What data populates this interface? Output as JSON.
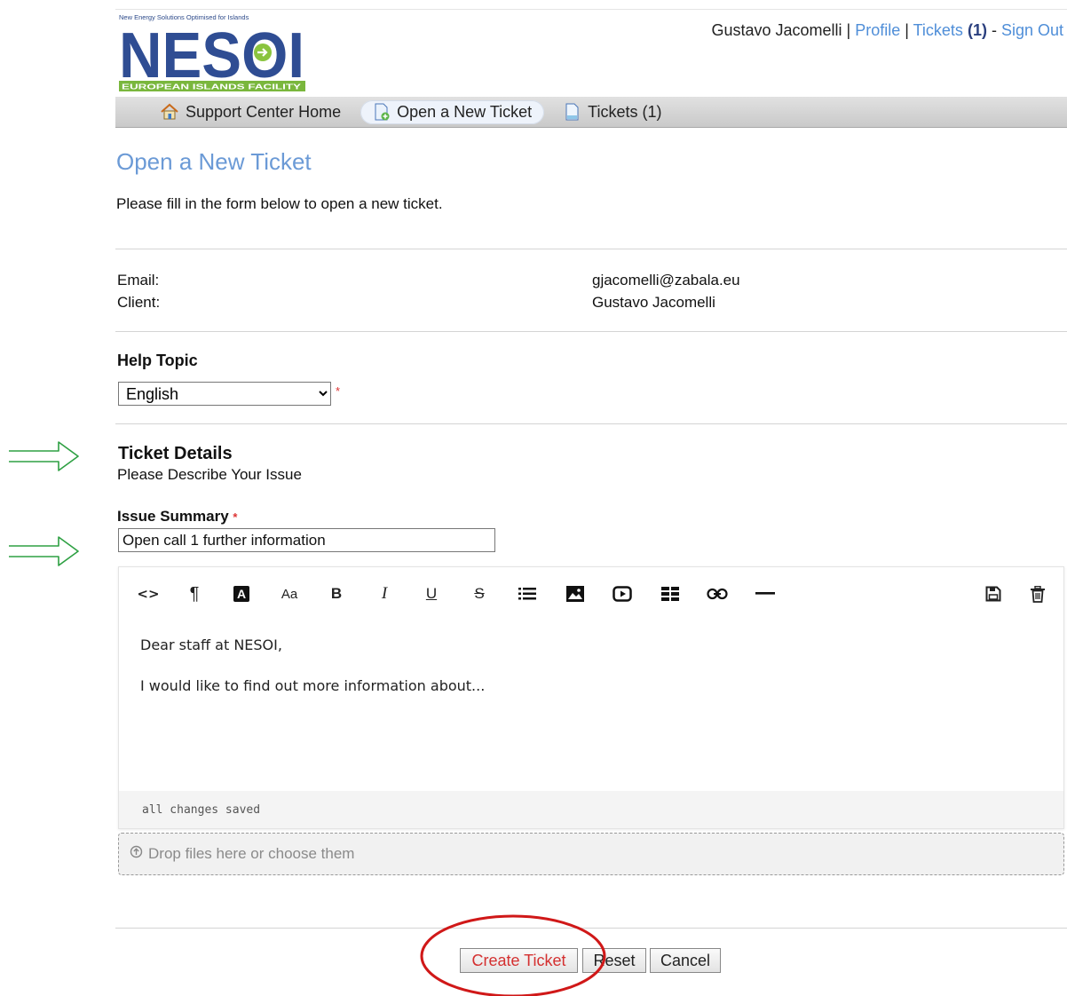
{
  "header": {
    "logo": {
      "tagline": "New Energy Solutions Optimised for Islands",
      "wordmark": "NESOI",
      "facility": "EUROPEAN ISLANDS FACILITY"
    },
    "user_bar": {
      "user_name": "Gustavo Jacomelli",
      "sep1": " | ",
      "profile": "Profile",
      "sep2": " | ",
      "tickets": "Tickets",
      "tickets_count": "(1)",
      "sep3": " - ",
      "sign_out": "Sign Out"
    }
  },
  "nav": {
    "items": [
      {
        "label": "Support Center Home",
        "icon": "home-icon"
      },
      {
        "label": "Open a New Ticket",
        "icon": "new-ticket-icon"
      },
      {
        "label": "Tickets (1)",
        "icon": "tickets-icon"
      }
    ]
  },
  "page": {
    "title": "Open a New Ticket",
    "intro": "Please fill in the form below to open a new ticket."
  },
  "client_info": {
    "email_label": "Email:",
    "email_value": "gjacomelli@zabala.eu",
    "client_label": "Client:",
    "client_value": "Gustavo Jacomelli"
  },
  "help_topic": {
    "label": "Help Topic",
    "selected": "English",
    "required_mark": "*"
  },
  "ticket_details": {
    "title": "Ticket Details",
    "subtitle": "Please Describe Your Issue",
    "summary_label": "Issue Summary",
    "summary_required": "*",
    "summary_value": "Open call 1 further information"
  },
  "editor": {
    "toolbar_icons": [
      "code-icon",
      "paragraph-icon",
      "text-color-icon",
      "font-size-icon",
      "bold-icon",
      "italic-icon",
      "underline-icon",
      "strikethrough-icon",
      "list-icon",
      "image-icon",
      "video-icon",
      "table-icon",
      "link-icon",
      "horizontal-rule-icon",
      "save-icon",
      "trash-icon"
    ],
    "toolbar_text": {
      "code": "<>",
      "paragraph": "¶",
      "text_color": "A",
      "font_size": "Aa",
      "bold": "B",
      "italic": "I",
      "underline": "U",
      "strike": "S"
    },
    "body_lines": [
      "Dear staff at NESOI,",
      "I would like to find out more information about..."
    ],
    "status": "all changes saved"
  },
  "dropzone": {
    "icon": "upload-icon",
    "text": "Drop files here or choose them"
  },
  "buttons": {
    "create": "Create Ticket",
    "reset": "Reset",
    "cancel": "Cancel"
  },
  "colors": {
    "link": "#4f8ed8",
    "title": "#6b9ad6",
    "annotation_arrow": "#2ea043",
    "annotation_circle": "#d01818",
    "create_text": "#d43030"
  }
}
